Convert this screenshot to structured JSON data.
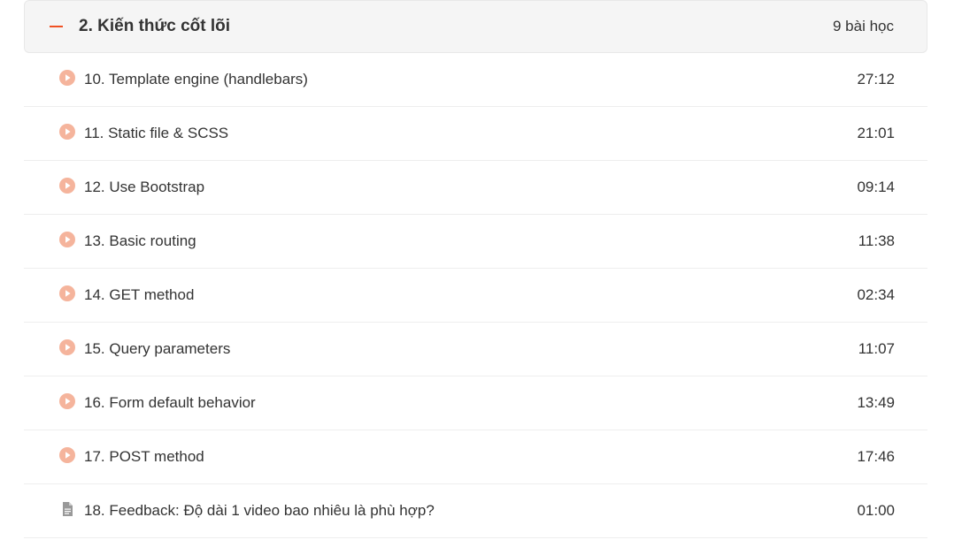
{
  "section": {
    "title": "2. Kiến thức cốt lõi",
    "lesson_count": "9 bài học",
    "accent_color": "#f05123",
    "expand_icon": "minus-icon"
  },
  "lessons": [
    {
      "title": "10. Template engine (handlebars)",
      "duration": "27:12",
      "icon": "play-circle-icon"
    },
    {
      "title": "11. Static file & SCSS",
      "duration": "21:01",
      "icon": "play-circle-icon"
    },
    {
      "title": "12. Use Bootstrap",
      "duration": "09:14",
      "icon": "play-circle-icon"
    },
    {
      "title": "13. Basic routing",
      "duration": "11:38",
      "icon": "play-circle-icon"
    },
    {
      "title": "14. GET method",
      "duration": "02:34",
      "icon": "play-circle-icon"
    },
    {
      "title": "15. Query parameters",
      "duration": "11:07",
      "icon": "play-circle-icon"
    },
    {
      "title": "16. Form default behavior",
      "duration": "13:49",
      "icon": "play-circle-icon"
    },
    {
      "title": "17. POST method",
      "duration": "17:46",
      "icon": "play-circle-icon"
    },
    {
      "title": "18. Feedback: Độ dài 1 video bao nhiêu là phù hợp?",
      "duration": "01:00",
      "icon": "document-icon"
    }
  ]
}
